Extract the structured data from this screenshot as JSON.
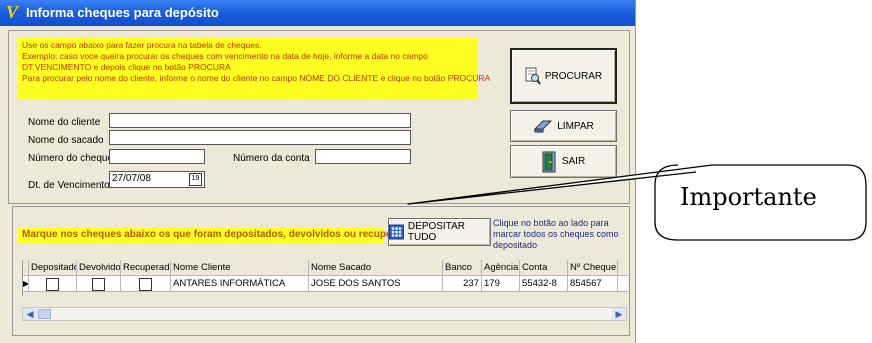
{
  "window": {
    "title": "Informa cheques para depósito",
    "app_icon_glyph": "V"
  },
  "hint": {
    "lines": [
      "Use os campo abaixo para fazer procura na tabela de cheques.",
      "Exemplo: caso voce queira procurar os cheques com vencimento na data de hoje, informe a data no campo",
      "DT.VENCIMENTO e depois clique no botão PROCURA",
      "Para procurar pelo nome do cliente, informe o nome do cliente no campo NOME DO CLIENTE e clique no botão PROCURA"
    ]
  },
  "form": {
    "cliente_label": "Nome do cliente",
    "cliente_value": "",
    "sacado_label": "Nome do sacado",
    "sacado_value": "",
    "cheque_label": "Número do cheque",
    "cheque_value": "",
    "conta_label": "Número da conta",
    "conta_value": "",
    "vencimento_label": "Dt. de Vencimento",
    "vencimento_value": "27/07/08",
    "calendar_glyph": "19"
  },
  "buttons": {
    "procurar": "PROCURAR",
    "limpar": "LIMPAR",
    "sair": "SAIR",
    "depositar_tudo": "DEPOSITAR TUDO"
  },
  "instructions": {
    "marque": "Marque nos cheques abaixo os que foram depositados, devolvidos ou recuperados",
    "clique": "Clique no botão ao lado para marcar todos os cheques como depositado"
  },
  "grid": {
    "columns": [
      "Depositado",
      "Devolvido",
      "Recuperado",
      "Nome Cliente",
      "Nome Sacado",
      "Banco",
      "Agência",
      "Conta",
      "Nº Cheque"
    ],
    "rows": [
      {
        "depositado": false,
        "devolvido": false,
        "recuperado": false,
        "nome_cliente": "ANTARES INFORMÁTICA",
        "nome_sacado": "JOSE DOS SANTOS",
        "banco": "237",
        "agencia": "179",
        "conta": "55432-8",
        "cheque": "854567"
      }
    ],
    "row_marker": "▶"
  },
  "annotation": {
    "text": "Importante"
  },
  "colors": {
    "title_bar": "#1c5fdc",
    "highlight": "#ffff22",
    "hint_text": "#cc3300"
  }
}
